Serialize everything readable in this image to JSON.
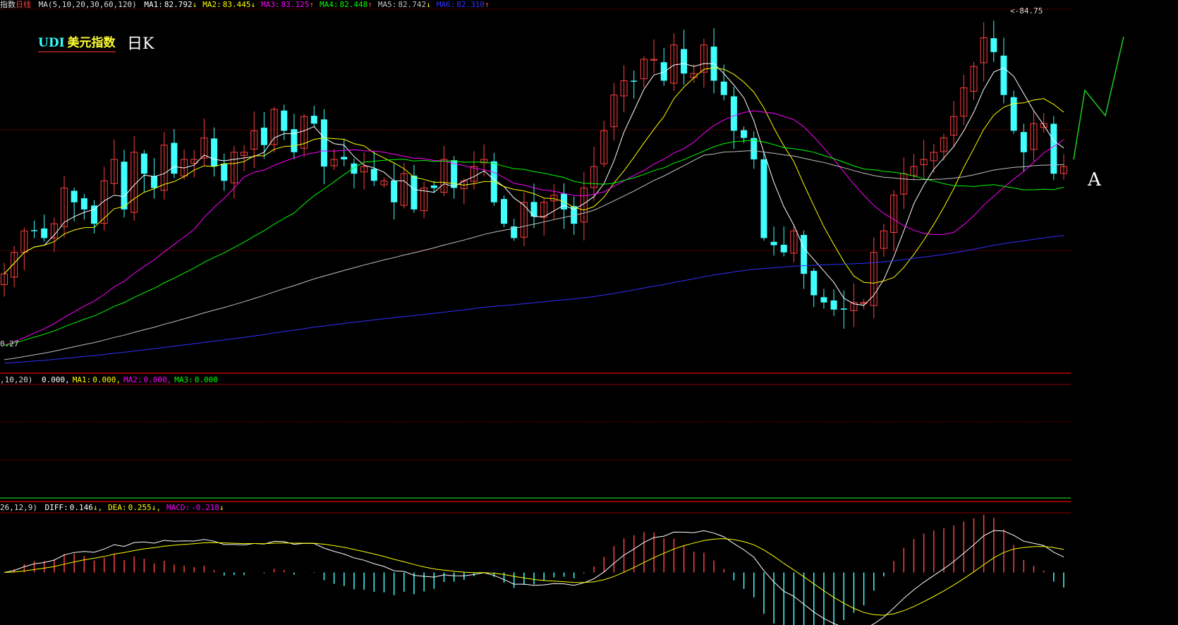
{
  "header_main": {
    "prefix": "指数",
    "period": "日线",
    "indicator": "MA(5,10,20,30,60,120)",
    "items": [
      {
        "label": "MA1:",
        "value": "82.792",
        "arrow": "↓",
        "color": "#ffffff"
      },
      {
        "label": "MA2:",
        "value": "83.445",
        "arrow": "↓",
        "color": "#ffff00"
      },
      {
        "label": "MA3:",
        "value": "83.125",
        "arrow": "↑",
        "color": "#ff00ff"
      },
      {
        "label": "MA4:",
        "value": "82.448",
        "arrow": "↑",
        "color": "#00ff00"
      },
      {
        "label": "MA5:",
        "value": "82.742",
        "arrow": "↓",
        "color": "#c0c0c0"
      },
      {
        "label": "MA6:",
        "value": "82.310",
        "arrow": "↑",
        "color": "#3030ff"
      }
    ]
  },
  "logo": {
    "en": "UDI",
    "cn": "美元指数"
  },
  "k_label": "日K",
  "a_label": "A",
  "peak_label": "84.75",
  "low_label": "0.27",
  "header_vol": {
    "indicator": ",10,20)",
    "items": [
      {
        "label": "",
        "value": "0.000,",
        "color": "#ffffff"
      },
      {
        "label": "MA1:",
        "value": "0.000,",
        "color": "#ffff00"
      },
      {
        "label": "MA2:",
        "value": "0.000,",
        "color": "#ff00ff"
      },
      {
        "label": "MA3:",
        "value": "0.000",
        "color": "#00ff00"
      }
    ]
  },
  "header_macd": {
    "indicator": "26,12,9)",
    "items": [
      {
        "label": "DIFF:",
        "value": "0.146",
        "arrow": "↓,",
        "color": "#ffffff"
      },
      {
        "label": "DEA:",
        "value": "0.255",
        "arrow": "↓,",
        "color": "#ffff00"
      },
      {
        "label": "MACD:",
        "value": "-0.218",
        "arrow": "↓",
        "color": "#ff00ff"
      }
    ]
  },
  "colors": {
    "up": "#ff4040",
    "down": "#40ffff",
    "grid": "#8b0000"
  },
  "chart_data": [
    {
      "type": "candlestick",
      "note_series": [
        "close"
      ],
      "ylim": [
        80.0,
        85.0
      ],
      "close": [
        81.3,
        81.6,
        81.9,
        81.9,
        81.8,
        82.0,
        82.5,
        82.3,
        82.2,
        82.0,
        82.6,
        82.9,
        82.2,
        83.0,
        82.7,
        82.5,
        83.1,
        82.7,
        82.9,
        82.9,
        83.2,
        82.8,
        82.6,
        83.0,
        83.0,
        83.3,
        83.1,
        83.6,
        83.3,
        83.0,
        83.5,
        83.4,
        82.8,
        82.9,
        82.9,
        82.7,
        82.8,
        82.6,
        82.6,
        82.3,
        82.7,
        82.2,
        82.5,
        82.5,
        82.9,
        82.5,
        82.6,
        82.8,
        82.9,
        82.3,
        82.0,
        81.8,
        82.3,
        82.1,
        82.3,
        82.4,
        82.2,
        82.0,
        82.5,
        82.8,
        83.3,
        83.8,
        84.0,
        84.0,
        84.3,
        84.3,
        84.0,
        84.5,
        84.1,
        84.1,
        84.5,
        84.0,
        83.8,
        83.3,
        83.2,
        82.9,
        81.8,
        81.7,
        81.6,
        81.9,
        81.3,
        81.0,
        80.9,
        80.8,
        80.8,
        80.9,
        80.9,
        81.6,
        81.9,
        82.4,
        82.7,
        82.8,
        82.9,
        83.0,
        83.2,
        83.5,
        83.9,
        84.2,
        84.6,
        84.4,
        83.8,
        83.3,
        83.0,
        83.4,
        83.4,
        82.7,
        82.8
      ],
      "ma_series": [
        "MA1",
        "MA2",
        "MA3",
        "MA4",
        "MA5",
        "MA6"
      ]
    },
    {
      "type": "bar",
      "title": "MACD",
      "series": [
        {
          "name": "DIFF"
        },
        {
          "name": "DEA"
        },
        {
          "name": "MACD"
        }
      ],
      "ylim": [
        -0.6,
        0.6
      ]
    }
  ]
}
